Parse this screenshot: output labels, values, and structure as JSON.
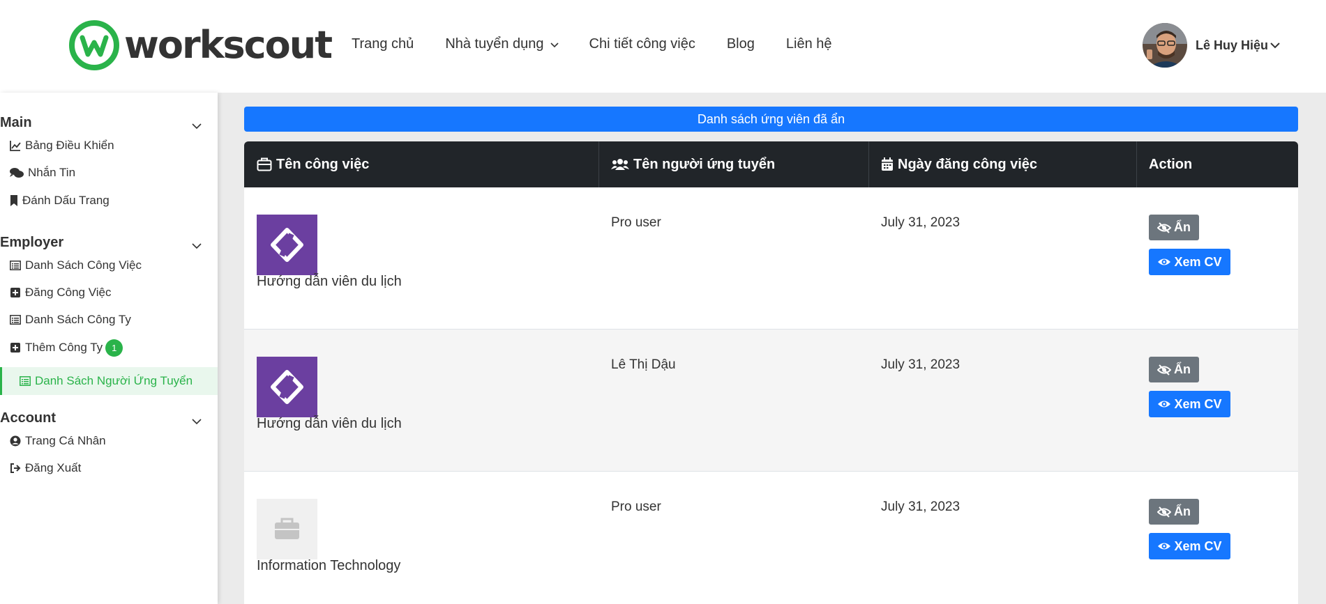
{
  "header": {
    "logo_text": "workscout",
    "nav": [
      {
        "label": "Trang chủ"
      },
      {
        "label": "Nhà tuyển dụng"
      },
      {
        "label": "Chi tiết công việc"
      },
      {
        "label": "Blog"
      },
      {
        "label": "Liên hệ"
      }
    ],
    "user_name": "Lê Huy Hiệu"
  },
  "sidebar": {
    "sections": [
      {
        "title": "Main",
        "items": [
          {
            "label": "Bảng Điều Khiển",
            "icon": "chart-line-icon"
          },
          {
            "label": "Nhắn Tin",
            "icon": "comments-icon"
          },
          {
            "label": "Đánh Dấu Trang",
            "icon": "bookmark-icon"
          }
        ]
      },
      {
        "title": "Employer",
        "items": [
          {
            "label": "Danh Sách Công Việc",
            "icon": "list-icon"
          },
          {
            "label": "Đăng Công Việc",
            "icon": "plus-square-icon"
          },
          {
            "label": "Danh Sách Công Ty",
            "icon": "list-icon"
          },
          {
            "label": "Thêm Công Ty",
            "icon": "plus-square-icon",
            "badge": "1"
          },
          {
            "label": "Danh Sách Người Ứng Tuyển",
            "icon": "list-icon",
            "active": true
          }
        ]
      },
      {
        "title": "Account",
        "items": [
          {
            "label": "Trang Cá Nhân",
            "icon": "user-circle-icon"
          },
          {
            "label": "Đăng Xuất",
            "icon": "sign-out-icon"
          }
        ]
      }
    ]
  },
  "main": {
    "banner": "Danh sách ứng viên đã ẩn",
    "columns": [
      "Tên công việc",
      "Tên người ứng tuyển",
      "Ngày đăng công việc",
      "Action"
    ],
    "rows": [
      {
        "job": "Hướng dẫn viên du lịch",
        "applicant": "Pro user",
        "date": "July 31, 2023",
        "logo": "purple"
      },
      {
        "job": "Hướng dẫn viên du lịch",
        "applicant": "Lê Thị Dậu",
        "date": "July 31, 2023",
        "logo": "purple"
      },
      {
        "job": "Information Technology",
        "applicant": "Pro user",
        "date": "July 31, 2023",
        "logo": "placeholder"
      }
    ],
    "hide_label": "Ẩn",
    "view_cv_label": "Xem CV"
  },
  "colors": {
    "brand_green": "#2ab34a",
    "primary_blue": "#1677ff",
    "table_header": "#212529",
    "thumb_purple": "#6b3fa0"
  }
}
